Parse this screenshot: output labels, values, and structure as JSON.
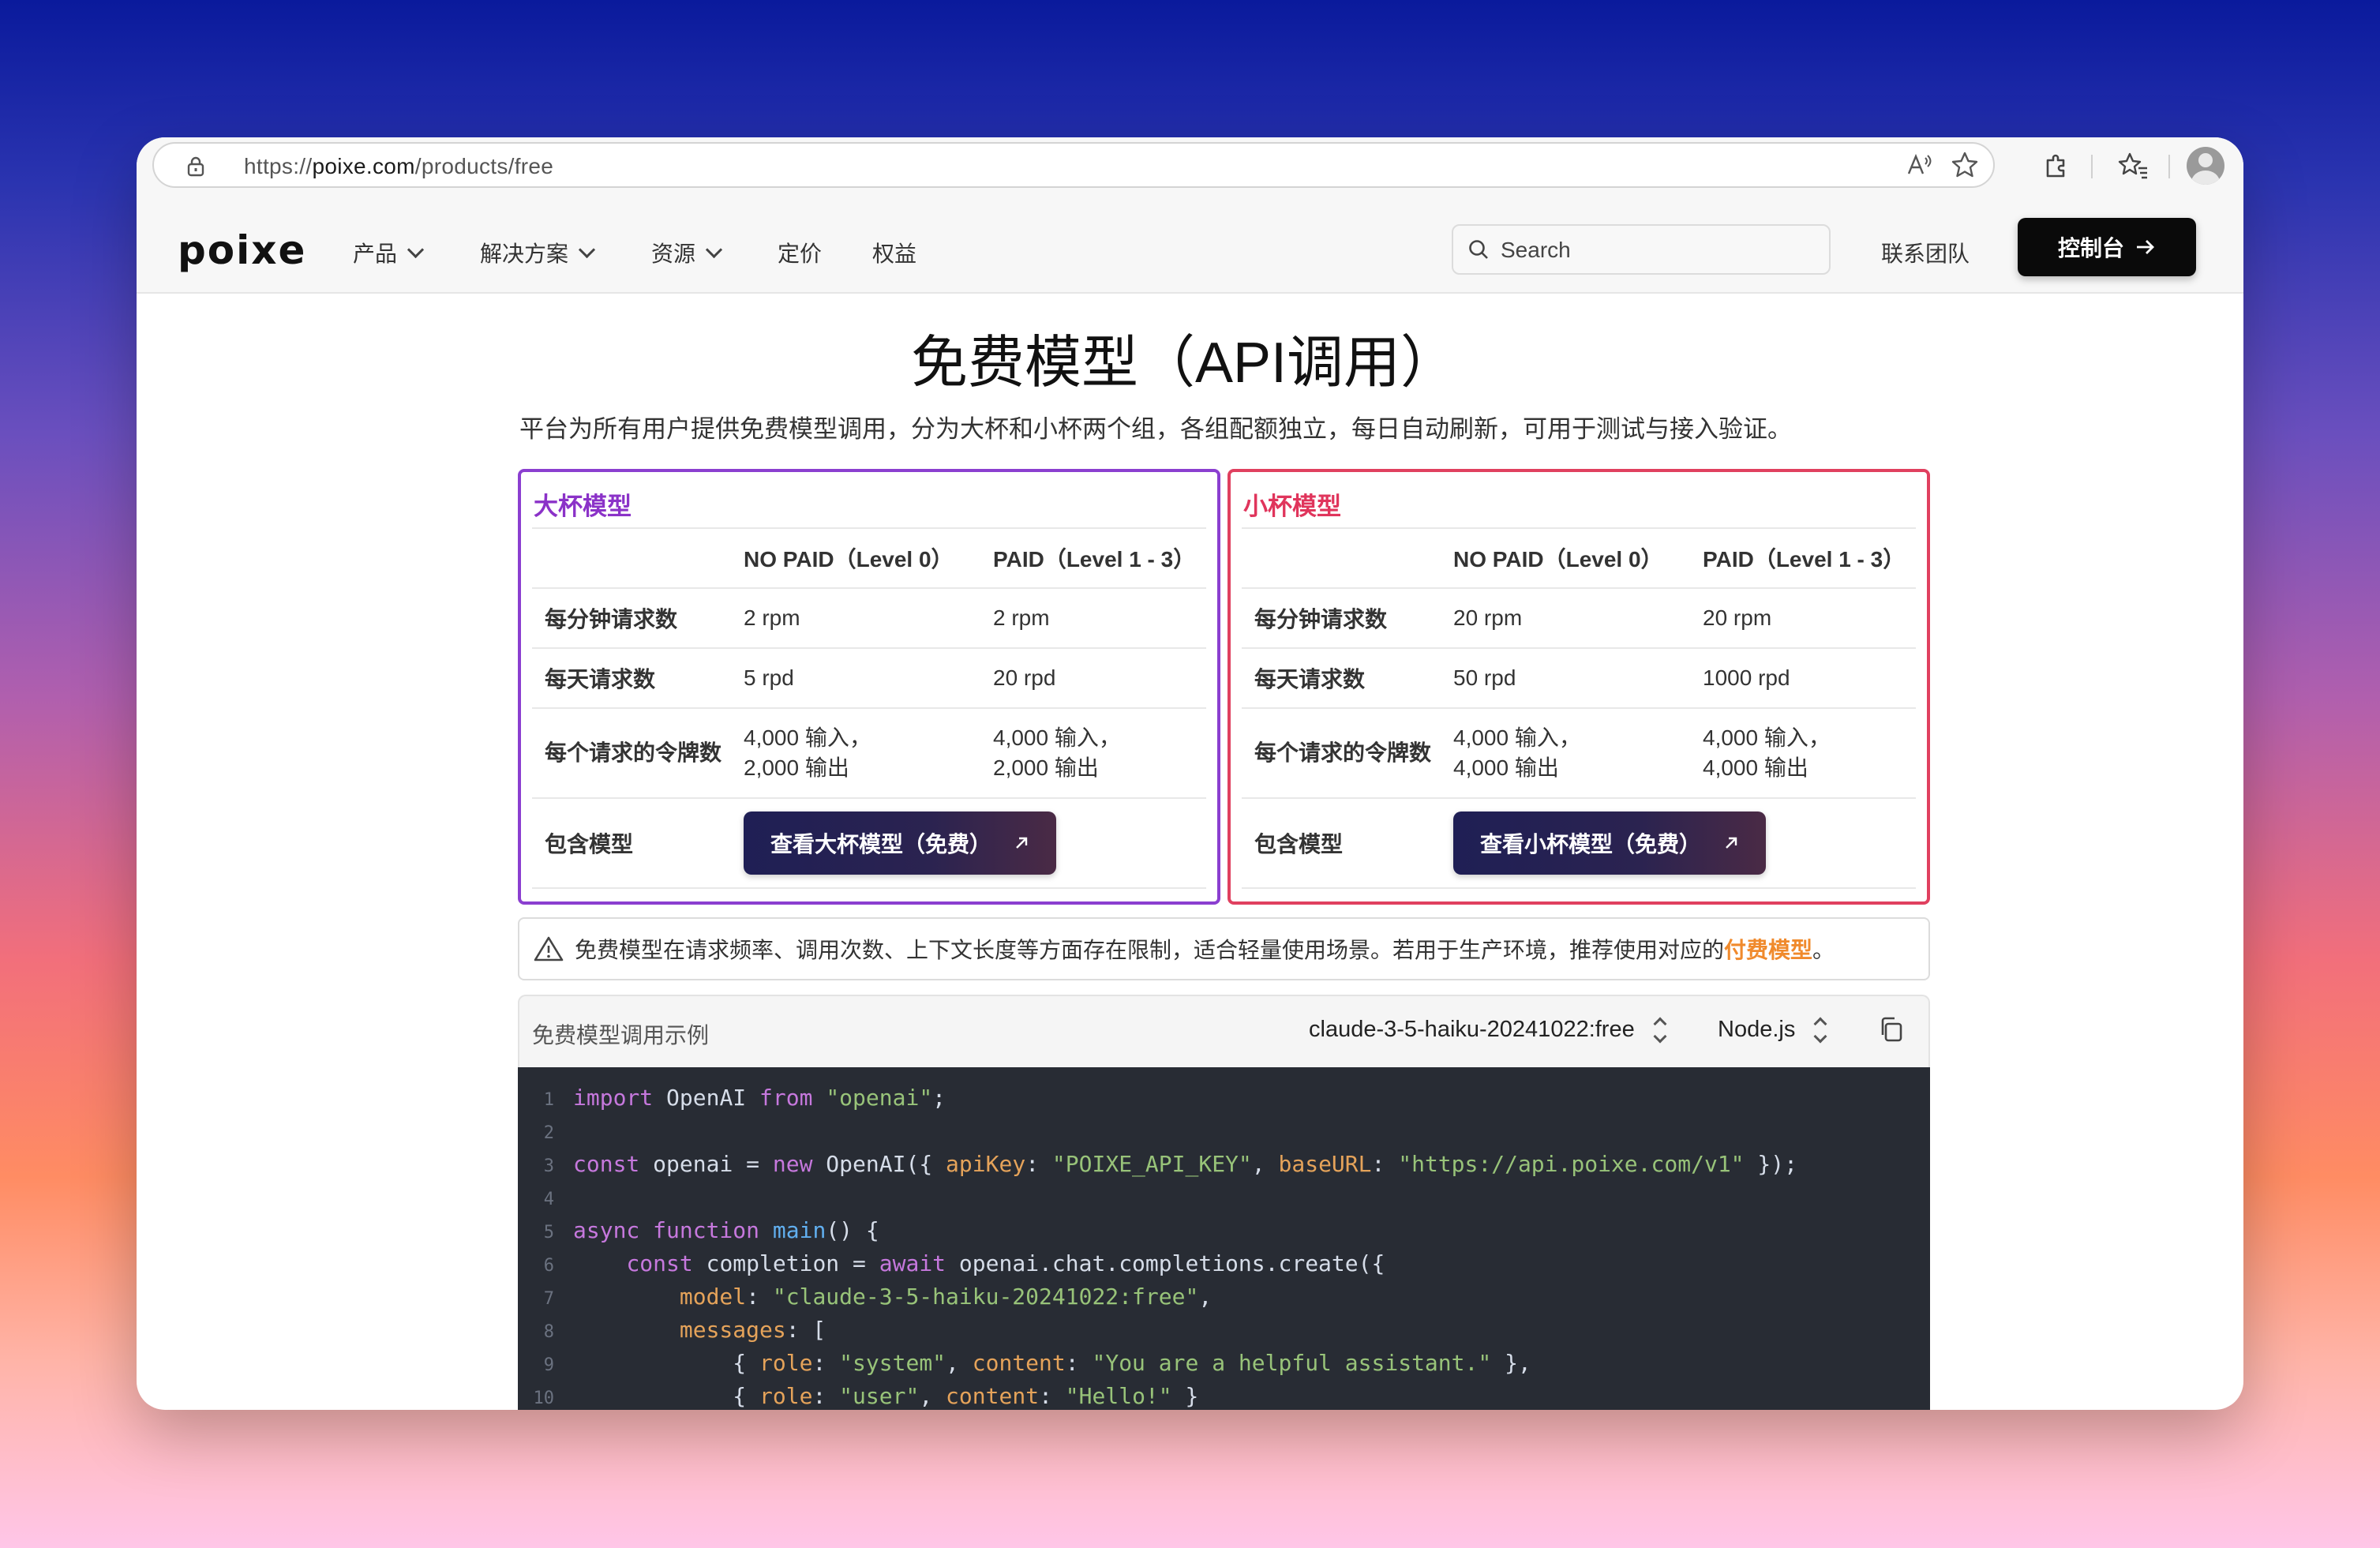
{
  "browser": {
    "url_prefix": "https://",
    "url_host": "poixe.com",
    "url_path": "/products/free"
  },
  "nav": {
    "logo": "poixe",
    "items": [
      "产品",
      "解决方案",
      "资源",
      "定价",
      "权益"
    ],
    "search_placeholder": "Search",
    "contact": "联系团队",
    "console": "控制台"
  },
  "page": {
    "title": "免费模型（API调用）",
    "subtitle": "平台为所有用户提供免费模型调用，分为大杯和小杯两个组，各组配额独立，每日自动刷新，可用于测试与接入验证。"
  },
  "big_card": {
    "title": "大杯模型",
    "col1": "NO PAID（Level 0）",
    "col2": "PAID（Level 1 - 3）",
    "rows": [
      {
        "label": "每分钟请求数",
        "v1": "2 rpm",
        "v2": "2 rpm"
      },
      {
        "label": "每天请求数",
        "v1": "5 rpd",
        "v2": "20 rpd"
      },
      {
        "label": "每个请求的令牌数",
        "v1": "4,000 输入，\n2,000 输出",
        "v2": "4,000 输入，\n2,000 输出"
      }
    ],
    "models_label": "包含模型",
    "button": "查看大杯模型（免费）",
    "accent": "#8b3fd0"
  },
  "small_card": {
    "title": "小杯模型",
    "col1": "NO PAID（Level 0）",
    "col2": "PAID（Level 1 - 3）",
    "rows": [
      {
        "label": "每分钟请求数",
        "v1": "20 rpm",
        "v2": "20 rpm"
      },
      {
        "label": "每天请求数",
        "v1": "50 rpd",
        "v2": "1000 rpd"
      },
      {
        "label": "每个请求的令牌数",
        "v1": "4,000 输入，\n4,000 输出",
        "v2": "4,000 输入，\n4,000 输出"
      }
    ],
    "models_label": "包含模型",
    "button": "查看小杯模型（免费）",
    "accent": "#e0405f"
  },
  "notice": {
    "text": "免费模型在请求频率、调用次数、上下文长度等方面存在限制，适合轻量使用场景。若用于生产环境，推荐使用对应的",
    "link": "付费模型",
    "end": "。"
  },
  "code_example": {
    "label": "免费模型调用示例",
    "model_select": "claude-3-5-haiku-20241022:free",
    "lang_select": "Node.js",
    "line_numbers": [
      "1",
      "2",
      "3",
      "4",
      "5",
      "6",
      "7",
      "8",
      "9",
      "10"
    ]
  }
}
